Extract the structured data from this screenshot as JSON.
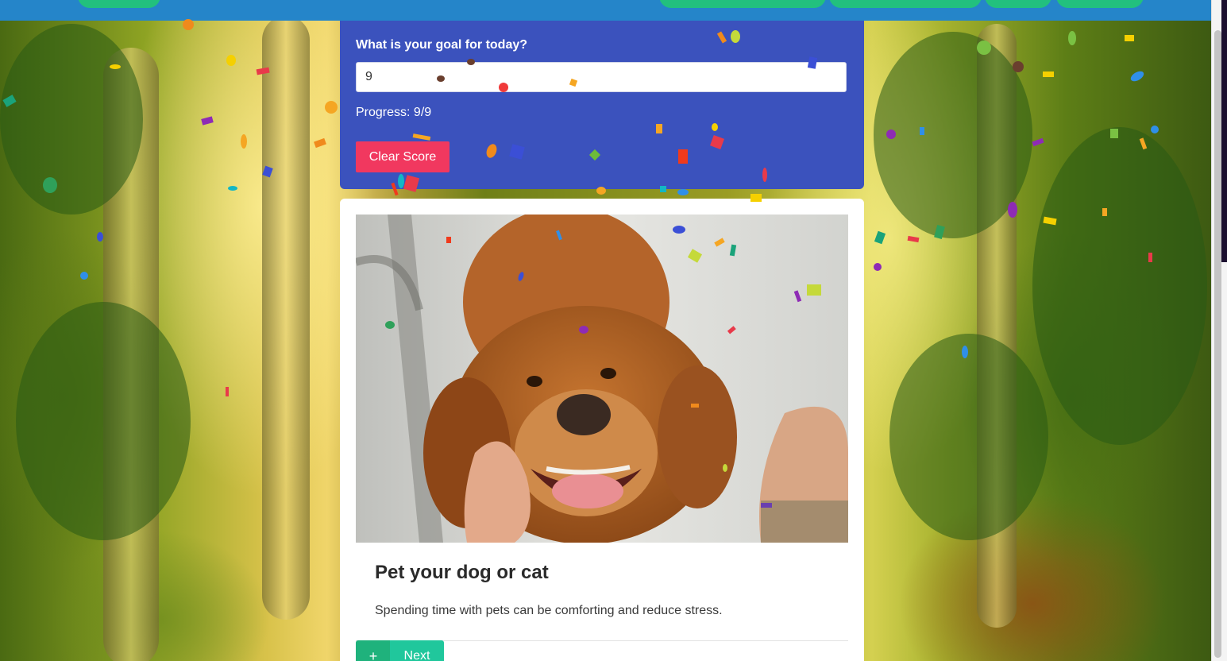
{
  "goal": {
    "label": "What is your goal for today?",
    "input_value": "9",
    "progress_text": "Progress: 9/9",
    "clear_button": "Clear Score"
  },
  "card": {
    "title": "Pet your dog or cat",
    "description": "Spending time with pets can be comforting and reduce stress.",
    "add_button": "+",
    "next_button": "Next"
  },
  "colors": {
    "topbar": "#2585c9",
    "nav_pill": "#22c07e",
    "goal_panel": "#3b52bd",
    "clear_button": "#f1385f",
    "add_button": "#1fb27c",
    "next_button": "#20c79c"
  }
}
